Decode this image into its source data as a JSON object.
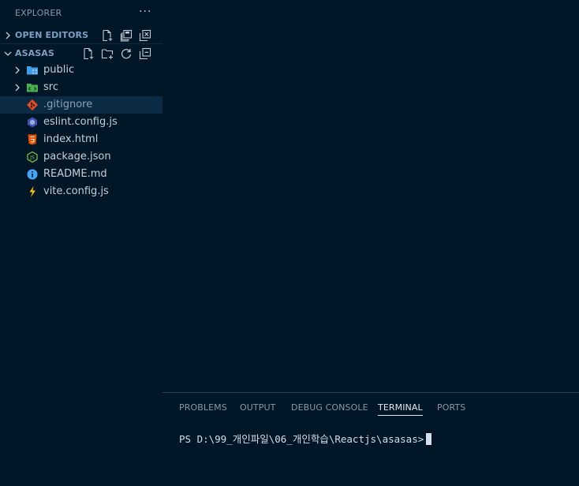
{
  "colors": {
    "background": "#011627",
    "selected_row": "#0b2a43",
    "section_label": "#7e9fc2",
    "text": "#c5cdd6",
    "folder_public": "#3d9de8",
    "folder_src": "#4caf50",
    "git": "#e64a19",
    "html": "#e65100",
    "json": "#8bc34a",
    "info": "#42a5f5",
    "vite": "#ffc107"
  },
  "sidebar": {
    "title": "EXPLORER",
    "more_label": "···",
    "open_editors": {
      "label": "OPEN EDITORS",
      "actions": [
        "new-file-icon",
        "save-all-icon",
        "close-all-icon"
      ]
    },
    "project": {
      "label": "ASASAS",
      "actions": [
        "new-file-icon",
        "new-folder-icon",
        "refresh-icon",
        "collapse-all-icon"
      ]
    },
    "items": [
      {
        "label": "public",
        "type": "folder",
        "icon": "folder-public-icon",
        "expanded": false
      },
      {
        "label": "src",
        "type": "folder",
        "icon": "folder-src-icon",
        "expanded": false
      },
      {
        "label": ".gitignore",
        "type": "file",
        "icon": "git-icon",
        "selected": true
      },
      {
        "label": "eslint.config.js",
        "type": "file",
        "icon": "eslint-icon"
      },
      {
        "label": "index.html",
        "type": "file",
        "icon": "html-icon"
      },
      {
        "label": "package.json",
        "type": "file",
        "icon": "nodejs-icon"
      },
      {
        "label": "README.md",
        "type": "file",
        "icon": "info-icon"
      },
      {
        "label": "vite.config.js",
        "type": "file",
        "icon": "vite-icon"
      }
    ]
  },
  "panel": {
    "tabs": [
      {
        "label": "PROBLEMS",
        "active": false
      },
      {
        "label": "OUTPUT",
        "active": false
      },
      {
        "label": "DEBUG CONSOLE",
        "active": false
      },
      {
        "label": "TERMINAL",
        "active": true
      },
      {
        "label": "PORTS",
        "active": false
      }
    ],
    "terminal_prompt": "PS D:\\99_개인파일\\06_개인학습\\Reactjs\\asasas>"
  }
}
